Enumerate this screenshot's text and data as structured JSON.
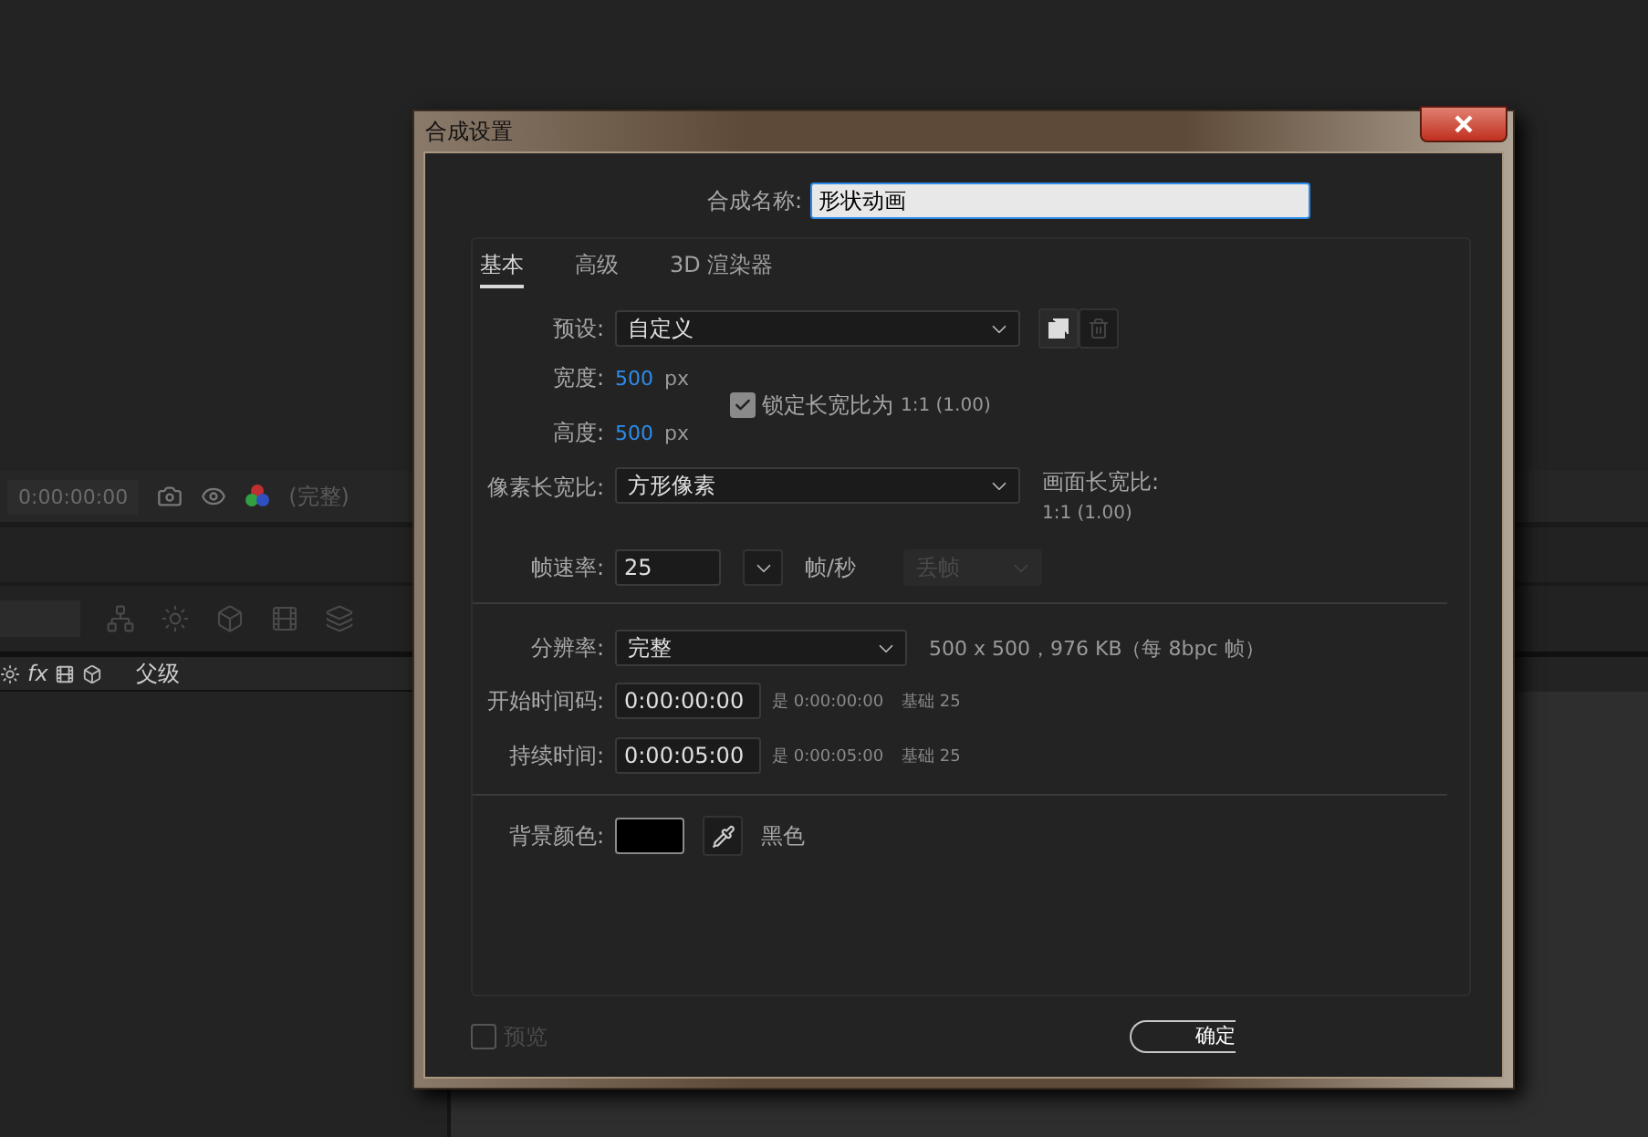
{
  "background": {
    "viewer_toolbar": {
      "timecode": "0:00:00:00",
      "resolution": "(完整)"
    },
    "layer_header": {
      "fx_label": "fx",
      "parent_label": "父级"
    }
  },
  "dialog": {
    "title": "合成设置",
    "comp_name": {
      "label": "合成名称:",
      "value": "形状动画"
    },
    "tabs": [
      {
        "label": "基本",
        "selected": true
      },
      {
        "label": "高级",
        "selected": false
      },
      {
        "label": "3D 渲染器",
        "selected": false
      }
    ],
    "preset": {
      "label": "预设:",
      "value": "自定义"
    },
    "width": {
      "label": "宽度:",
      "value": "500",
      "unit": "px"
    },
    "height": {
      "label": "高度:",
      "value": "500",
      "unit": "px"
    },
    "lock_aspect": {
      "label": "锁定长宽比为",
      "ratio": "1:1 (1.00)",
      "checked": true
    },
    "pixel_aspect": {
      "label": "像素长宽比:",
      "value": "方形像素"
    },
    "frame_aspect": {
      "label": "画面长宽比:",
      "value": "1:1 (1.00)"
    },
    "frame_rate": {
      "label": "帧速率:",
      "value": "25",
      "unit": "帧/秒",
      "drop_frame": "丢帧"
    },
    "resolution": {
      "label": "分辨率:",
      "value": "完整",
      "info": "500 x 500，976 KB（每 8bpc 帧）"
    },
    "start_timecode": {
      "label": "开始时间码:",
      "value": "0:00:00:00",
      "equivalent": "是 0:00:00:00",
      "base": "基础 25"
    },
    "duration": {
      "label": "持续时间:",
      "value": "0:00:05:00",
      "equivalent": "是 0:00:05:00",
      "base": "基础 25"
    },
    "background_color": {
      "label": "背景颜色:",
      "color": "#000000",
      "name": "黑色"
    },
    "preview": {
      "label": "预览",
      "checked": false
    },
    "ok_button": "确定"
  }
}
